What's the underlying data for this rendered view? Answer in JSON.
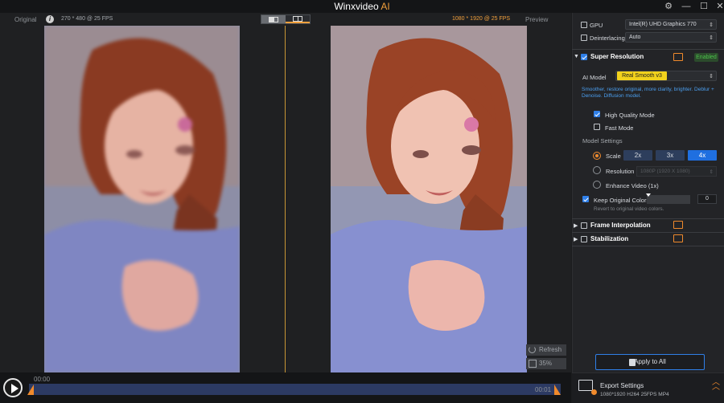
{
  "app": {
    "title_main": "Winxvideo",
    "title_ai": "AI"
  },
  "window_controls": {
    "settings": "⚙",
    "minimize": "—",
    "maximize": "☐",
    "close": "✕"
  },
  "preview": {
    "original_label": "Original",
    "info_icon_glyph": "i",
    "source_resolution": "270 * 480 @ 25 FPS",
    "output_resolution": "1080 * 1920 @ 25 FPS",
    "preview_label": "Preview",
    "refresh_label": "Refresh",
    "zoom_label": "35%"
  },
  "playback": {
    "time_start": "00:00",
    "time_end": "00:01",
    "progress": 0.0
  },
  "settings": {
    "gpu": {
      "label": "GPU",
      "value": "Intel(R) UHD Graphics 770",
      "checked": false
    },
    "deinterlacing": {
      "label": "Deinterlacing",
      "value": "Auto",
      "checked": false
    },
    "super_resolution": {
      "title": "Super Resolution",
      "status": "Enabled",
      "ai_model_label": "AI Model",
      "ai_model_value": "Real Smooth v3",
      "description": "Smoother, restore original, more clarity, brighter. Deblur + Denoise. Diffusion model.",
      "high_quality_mode": "High Quality Mode",
      "fast_mode": "Fast Mode",
      "model_settings_label": "Model Settings",
      "scale_label": "Scale",
      "scale_options": [
        "2x",
        "3x",
        "4x"
      ],
      "scale_selected": "4x",
      "resolution_label": "Resolution",
      "resolution_value": "1080P (1920 X 1080)",
      "enhance_video_label": "Enhance Video (1x)",
      "keep_colors_label": "Keep Original Colors",
      "keep_colors_value": "0",
      "revert_hint": "Revert to original video colors."
    },
    "frame_interpolation": {
      "title": "Frame Interpolation"
    },
    "stabilization": {
      "title": "Stabilization"
    },
    "apply_button": "Apply to All",
    "export": {
      "title": "Export Settings",
      "info": "1080*1920  H264  25FPS  MP4"
    }
  },
  "colors": {
    "accent_orange": "#f08a2c",
    "accent_blue": "#2f7fe8",
    "model_pill": "#f2d21c",
    "enabled_green": "#4bc24b"
  }
}
